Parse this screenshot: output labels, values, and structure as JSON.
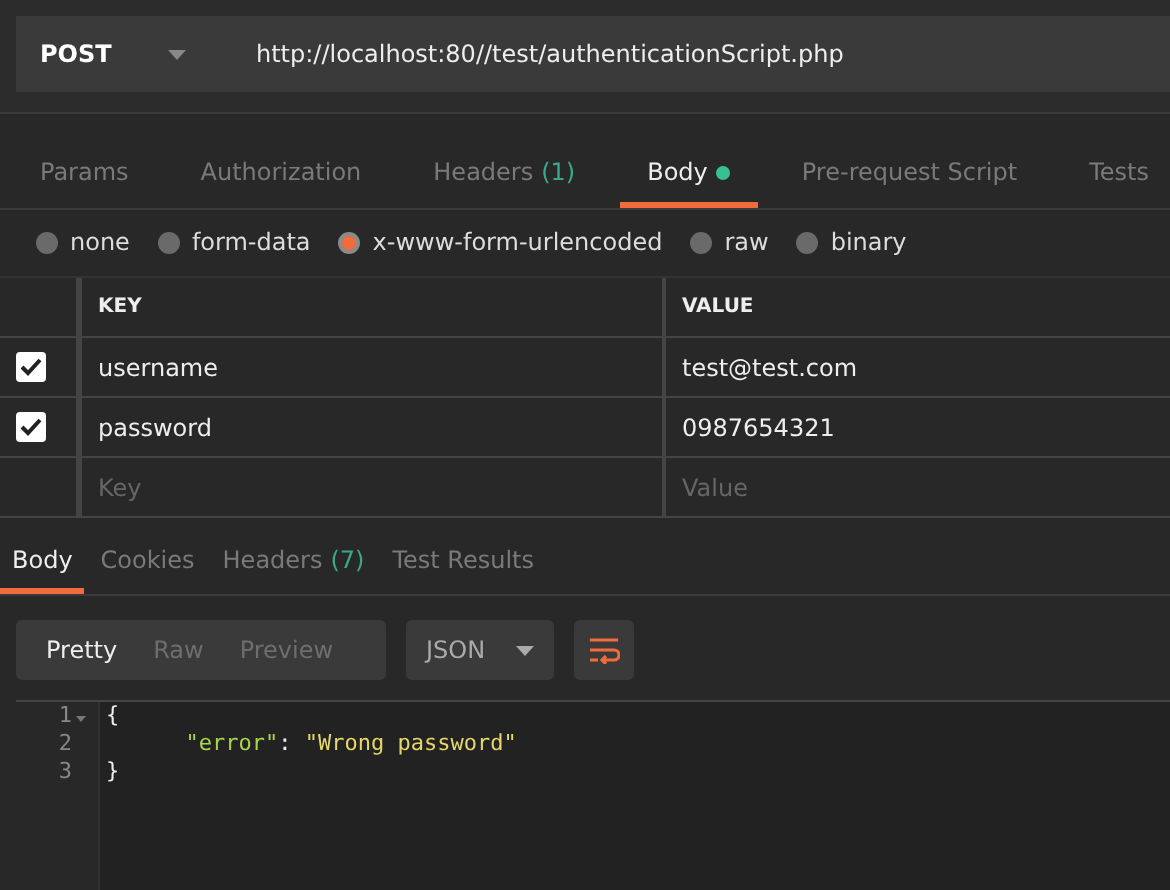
{
  "request": {
    "method": "POST",
    "url": "http://localhost:80//test/authenticationScript.php"
  },
  "request_tabs": [
    {
      "label": "Params",
      "selected": false
    },
    {
      "label": "Authorization",
      "selected": false
    },
    {
      "label": "Headers",
      "count": "(1)",
      "selected": false
    },
    {
      "label": "Body",
      "indicator": true,
      "selected": true
    },
    {
      "label": "Pre-request Script",
      "selected": false
    },
    {
      "label": "Tests",
      "selected": false
    }
  ],
  "body_types": [
    {
      "label": "none",
      "selected": false
    },
    {
      "label": "form-data",
      "selected": false
    },
    {
      "label": "x-www-form-urlencoded",
      "selected": true
    },
    {
      "label": "raw",
      "selected": false
    },
    {
      "label": "binary",
      "selected": false
    }
  ],
  "params_table": {
    "columns": [
      "KEY",
      "VALUE"
    ],
    "rows": [
      {
        "key": "username",
        "value": "test@test.com",
        "checked": true
      },
      {
        "key": "password",
        "value": "0987654321",
        "checked": true
      }
    ],
    "new_row": {
      "key_placeholder": "Key",
      "value_placeholder": "Value"
    }
  },
  "response_tabs": [
    {
      "label": "Body",
      "selected": true
    },
    {
      "label": "Cookies",
      "selected": false
    },
    {
      "label": "Headers",
      "count": "(7)",
      "selected": false
    },
    {
      "label": "Test Results",
      "selected": false
    }
  ],
  "view_modes": [
    {
      "label": "Pretty",
      "selected": true
    },
    {
      "label": "Raw",
      "selected": false
    },
    {
      "label": "Preview",
      "selected": false
    }
  ],
  "format": "JSON",
  "code_lines": [
    {
      "number": "1",
      "fold": true,
      "tokens": [
        {
          "kind": "punct",
          "text": "{"
        }
      ]
    },
    {
      "number": "2",
      "fold": false,
      "tokens": [
        {
          "kind": "key",
          "text": "\"error\""
        },
        {
          "kind": "punct",
          "text": ": "
        },
        {
          "kind": "string",
          "text": "\"Wrong password\""
        }
      ]
    },
    {
      "number": "3",
      "fold": false,
      "tokens": [
        {
          "kind": "punct",
          "text": "}"
        }
      ]
    }
  ]
}
